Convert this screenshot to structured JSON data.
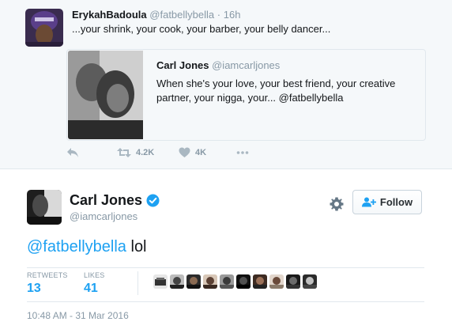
{
  "context_tweet": {
    "author_name": "ErykahBadoula",
    "author_handle": "@fatbellybella",
    "separator": "·",
    "time": "16h",
    "text": "...your shrink, your cook, your barber, your belly dancer...",
    "quoted": {
      "author_name": "Carl Jones",
      "author_handle": "@iamcarljones",
      "text": "When she's your love, your best friend, your creative partner, your nigga, your... @fatbellybella"
    },
    "actions": [
      {
        "icon": "reply-icon",
        "count": ""
      },
      {
        "icon": "retweet-icon",
        "count": "4.2K"
      },
      {
        "icon": "heart-icon",
        "count": "4K"
      },
      {
        "icon": "more-icon",
        "count": ""
      }
    ]
  },
  "main_tweet": {
    "author_name": "Carl Jones",
    "author_handle": "@iamcarljones",
    "verified": true,
    "follow_label": "Follow",
    "mention": "@fatbellybella",
    "text": " lol",
    "stats": {
      "retweets_label": "RETWEETS",
      "retweets_value": "13",
      "likes_label": "LIKES",
      "likes_value": "41"
    },
    "liker_avatar_count": 10,
    "timestamp": "10:48 AM - 31 Mar 2016"
  },
  "colors": {
    "accent": "#1da1f2",
    "muted": "#8899a6",
    "context_bg": "#f5f8fa",
    "border": "#e1e8ed"
  }
}
